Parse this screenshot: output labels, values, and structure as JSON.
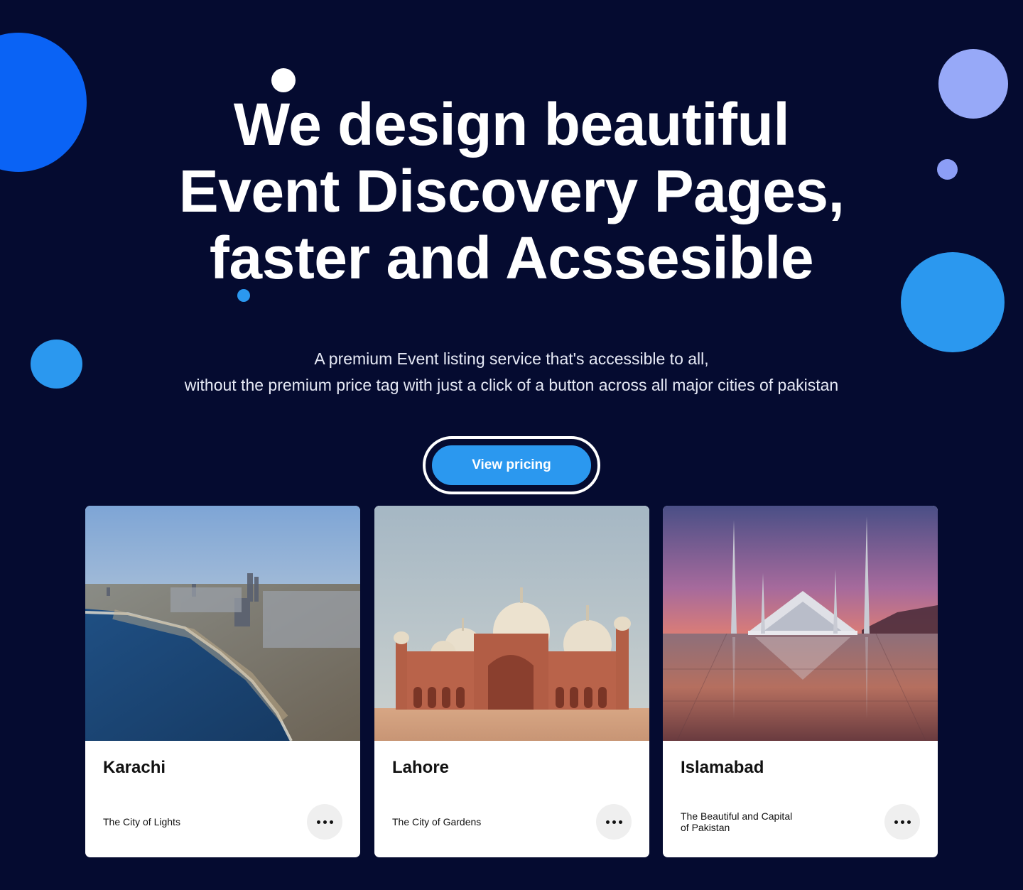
{
  "hero": {
    "title_line1": "We design beautiful",
    "title_line2": "Event Discovery Pages,",
    "title_line3": "faster and Acssesible",
    "subtitle_line1": "A premium Event listing service that's accessible to all,",
    "subtitle_line2": "without the premium price tag with just a click of a button across all major cities of pakistan"
  },
  "cta": {
    "label": "View pricing"
  },
  "cities": [
    {
      "name": "Karachi",
      "tagline": "The City of Lights",
      "image": "karachi-coastline-aerial"
    },
    {
      "name": "Lahore",
      "tagline": "The City of Gardens",
      "image": "badshahi-mosque"
    },
    {
      "name": "Islamabad",
      "tagline": "The Beautiful and Capital of Pakistan",
      "image": "faisal-mosque-sunset"
    }
  ],
  "icons": {
    "more": "more-horizontal-icon"
  },
  "colors": {
    "background": "#050b30",
    "accent": "#2b98ef",
    "blue_blob": "#0a63f5",
    "lavender_blob": "#97a9f8",
    "card": "#ffffff"
  }
}
